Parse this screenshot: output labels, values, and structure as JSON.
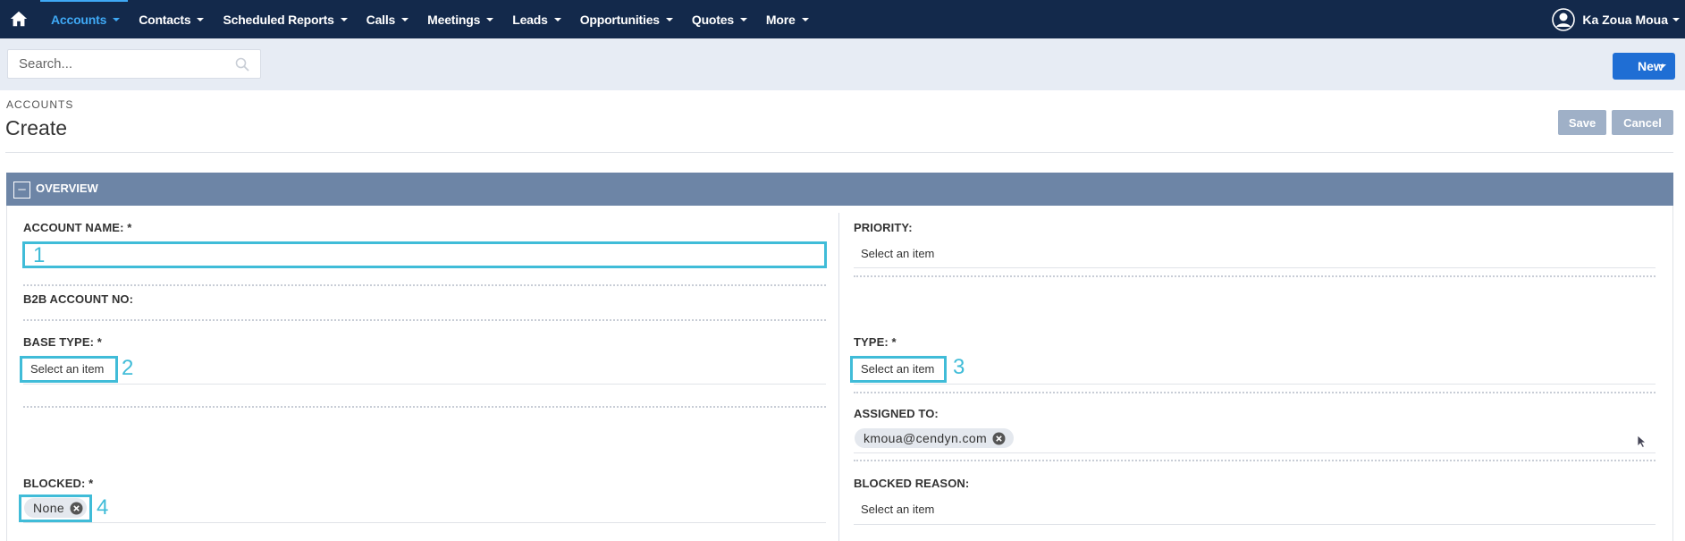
{
  "nav": {
    "items": [
      {
        "label": "Accounts"
      },
      {
        "label": "Contacts"
      },
      {
        "label": "Scheduled Reports"
      },
      {
        "label": "Calls"
      },
      {
        "label": "Meetings"
      },
      {
        "label": "Leads"
      },
      {
        "label": "Opportunities"
      },
      {
        "label": "Quotes"
      },
      {
        "label": "More"
      }
    ],
    "user_name": "Ka Zoua Moua",
    "active_color": "#3fa9f5",
    "bg_color": "#13294b"
  },
  "search": {
    "placeholder": "Search..."
  },
  "new_button": {
    "label": "New"
  },
  "header": {
    "module": "ACCOUNTS",
    "title": "Create",
    "save_label": "Save",
    "cancel_label": "Cancel"
  },
  "panel": {
    "title": "OVERVIEW",
    "collapse_symbol": "–"
  },
  "fields": {
    "account_name": {
      "label": "ACCOUNT NAME: *",
      "value": "",
      "marker": "1"
    },
    "b2b_account_no": {
      "label": "B2B ACCOUNT NO:"
    },
    "base_type": {
      "label": "BASE TYPE: *",
      "value": "Select an item",
      "marker": "2"
    },
    "blocked": {
      "label": "BLOCKED: *",
      "value": "None",
      "marker": "4"
    },
    "priority": {
      "label": "PRIORITY:",
      "value": "Select an item"
    },
    "type": {
      "label": "TYPE: *",
      "value": "Select an item",
      "marker": "3"
    },
    "assigned_to": {
      "label": "ASSIGNED TO:",
      "value": "kmoua@cendyn.com"
    },
    "blocked_reason": {
      "label": "BLOCKED REASON:",
      "value": "Select an item"
    }
  },
  "highlight_color": "#40bcd8"
}
